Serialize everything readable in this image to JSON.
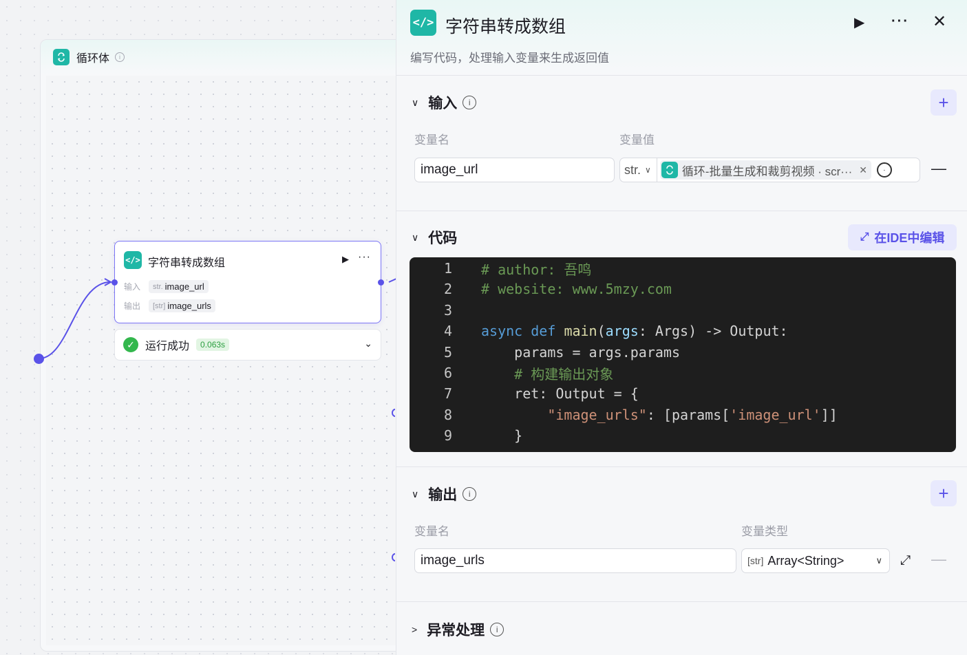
{
  "canvas": {
    "loop_title": "循环体",
    "node": {
      "title": "字符串转成数组",
      "input_label": "输入",
      "input_type": "str.",
      "input_name": "image_url",
      "output_label": "输出",
      "output_type": "[str]",
      "output_name": "image_urls"
    },
    "status": {
      "text": "运行成功",
      "time": "0.063s"
    }
  },
  "panel": {
    "title": "字符串转成数组",
    "description": "编写代码，处理输入变量来生成返回值",
    "input_section": {
      "title": "输入",
      "col_name": "变量名",
      "col_value": "变量值",
      "var_name": "image_url",
      "var_type": "str.",
      "ref_value": "循环-批量生成和裁剪视频 · scr···"
    },
    "code_section": {
      "title": "代码",
      "ide_button": "在IDE中编辑"
    },
    "output_section": {
      "title": "输出",
      "col_name": "变量名",
      "col_type": "变量类型",
      "var_name": "image_urls",
      "type_prefix": "[str]",
      "type_value": "Array<String>"
    },
    "error_section": {
      "title": "异常处理"
    }
  },
  "code_lines": [
    {
      "n": "1",
      "html": "<span class='c'># author: 吾鸣</span>"
    },
    {
      "n": "2",
      "html": "<span class='c'># website: www.5mzy.com</span>"
    },
    {
      "n": "3",
      "html": ""
    },
    {
      "n": "4",
      "html": "<span class='k'>async</span> <span class='k'>def</span> <span class='f'>main</span>(<span class='v'>args</span>: Args) -> Output:"
    },
    {
      "n": "5",
      "html": "    params = args.params"
    },
    {
      "n": "6",
      "html": "    <span class='c'># 构建输出对象</span>"
    },
    {
      "n": "7",
      "html": "    ret: Output = {"
    },
    {
      "n": "8",
      "html": "        <span class='s'>\"image_urls\"</span>: [params[<span class='s'>'image_url'</span>]]"
    },
    {
      "n": "9",
      "html": "    }"
    }
  ]
}
